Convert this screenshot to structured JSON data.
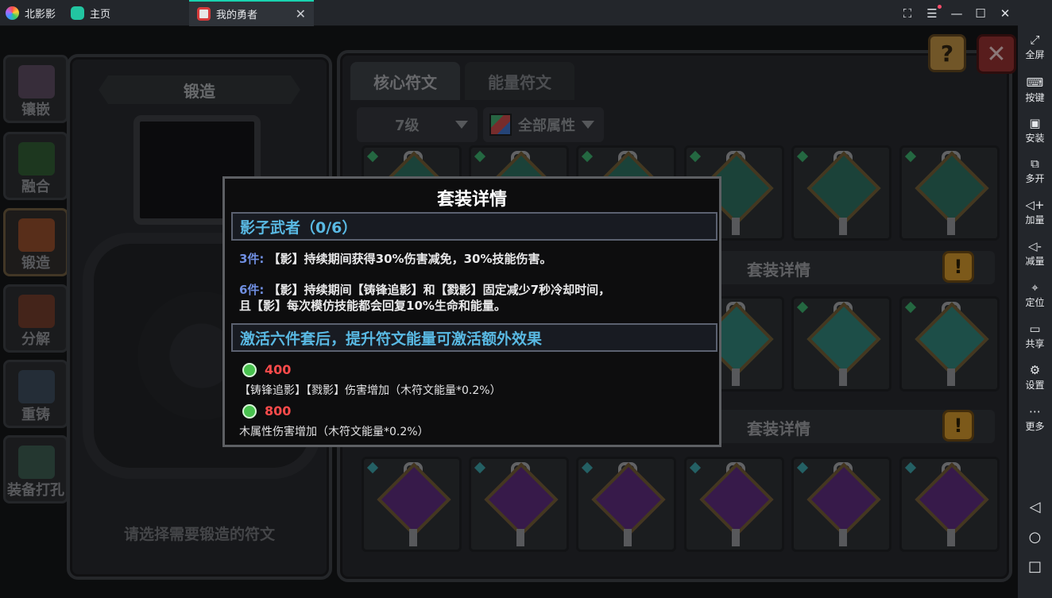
{
  "titlebar": {
    "app_name": "北影影",
    "home_tab": "主页",
    "game_tab": "我的勇者"
  },
  "sidebar": {
    "items": [
      {
        "icon": "fullscreen-icon",
        "label": "全屏"
      },
      {
        "icon": "keyboard-icon",
        "label": "按键"
      },
      {
        "icon": "apk-install-icon",
        "label": "安装"
      },
      {
        "icon": "multi-instance-icon",
        "label": "多开"
      },
      {
        "icon": "volume-up-icon",
        "label": "加量"
      },
      {
        "icon": "volume-down-icon",
        "label": "减量"
      },
      {
        "icon": "location-icon",
        "label": "定位"
      },
      {
        "icon": "folder-icon",
        "label": "共享"
      },
      {
        "icon": "settings-icon",
        "label": "设置"
      },
      {
        "icon": "more-icon",
        "label": "更多"
      }
    ]
  },
  "left_nav": [
    "镶嵌",
    "融合",
    "锻造",
    "分解",
    "重铸",
    "装备打孔"
  ],
  "forge": {
    "title": "锻造",
    "hint": "请选择需要锻造的符文"
  },
  "rune_tabs": [
    "核心符文",
    "能量符文"
  ],
  "filters": {
    "level": "7级",
    "attribute": "全部属性"
  },
  "set_bars": [
    "套装详情",
    "套装详情"
  ],
  "colors": {
    "accent_cyan": "#59b9e3",
    "energy_red": "#ff4b4b",
    "modal_bg": "#0d0d0e"
  },
  "modal": {
    "title": "套装详情",
    "set_name": "影子武者（0/6）",
    "bonus3_count": "3件:",
    "bonus3_text": "【影】持续期间获得30%伤害减免，30%技能伤害。",
    "bonus6_count": "6件:",
    "bonus6_text_1": "【影】持续期间【铸锋追影】和【戮影】固定减少7秒冷却时间，",
    "bonus6_text_2": "且【影】每次模仿技能都会回复10%生命和能量。",
    "extra_header": "激活六件套后，提升符文能量可激活额外效果",
    "extra": [
      {
        "energy": "400",
        "effect": "【铸锋追影】【戮影】伤害增加（木符文能量*0.2%）"
      },
      {
        "energy": "800",
        "effect": "木属性伤害增加（木符文能量*0.2%）"
      }
    ]
  }
}
